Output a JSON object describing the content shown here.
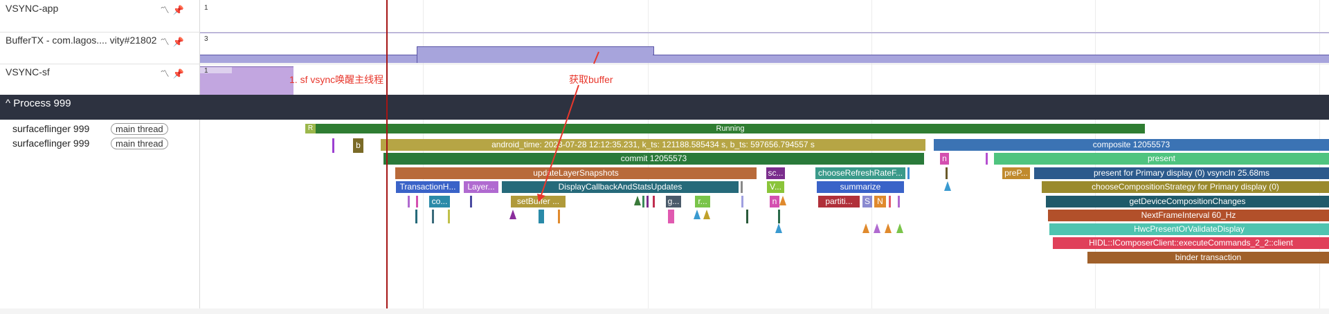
{
  "tracks": {
    "vsync_app": {
      "label": "VSYNC-app",
      "value": "1"
    },
    "buffer_tx": {
      "label": "BufferTX - com.lagos.... vity#21802",
      "value": "3"
    },
    "vsync_sf": {
      "label": "VSYNC-sf",
      "value": "1"
    }
  },
  "process": {
    "title": "^ Process 999"
  },
  "threads": [
    {
      "name": "surfaceflinger 999",
      "pill": "main thread"
    },
    {
      "name": "surfaceflinger 999",
      "pill": "main thread"
    }
  ],
  "slices": {
    "r": "R",
    "running": "Running",
    "b": "b",
    "android_time": "android_time: 2023-07-28 12:12:35.231, k_ts: 121188.585434 s, b_ts: 597656.794557 s",
    "composite": "composite 12055573",
    "commit": "commit 12055573",
    "n1": "n",
    "present": "present",
    "update_layer": "updateLayerSnapshots",
    "sc": "sc...",
    "choose_refresh": "chooseRefreshRateF...",
    "prep": "preP...",
    "present_primary": "present for Primary display (0) vsyncIn 25.68ms",
    "transaction": "TransactionH...",
    "layer": "Layer...",
    "display_callback": "DisplayCallbackAndStatsUpdates",
    "v": "V...",
    "summarize": "summarize",
    "choose_comp": "chooseCompositionStrategy for Primary display (0)",
    "co": "co...",
    "set_buffer": "setBuffer ...",
    "g": "g...",
    "r2": "r...",
    "n2": "n",
    "partiti": "partiti...",
    "s": "S",
    "n3": "N",
    "get_device": "getDeviceCompositionChanges",
    "next_frame": "NextFrameInterval 60_Hz",
    "hwc_present": "HwcPresentOrValidateDisplay",
    "hidl": "HIDL::IComposerClient::executeCommands_2_2::client",
    "binder": "binder transaction"
  },
  "annotations": {
    "sf_vsync": "1. sf vsync唤醒主线程",
    "get_buffer": "获取buffer"
  },
  "colors": {
    "counter_fill": "#a7a4dc",
    "vsync_sf_fill": "#c2a6e0",
    "annotation": "#e8372c",
    "cursor": "#a51515",
    "process_bar": "#2d3240"
  }
}
